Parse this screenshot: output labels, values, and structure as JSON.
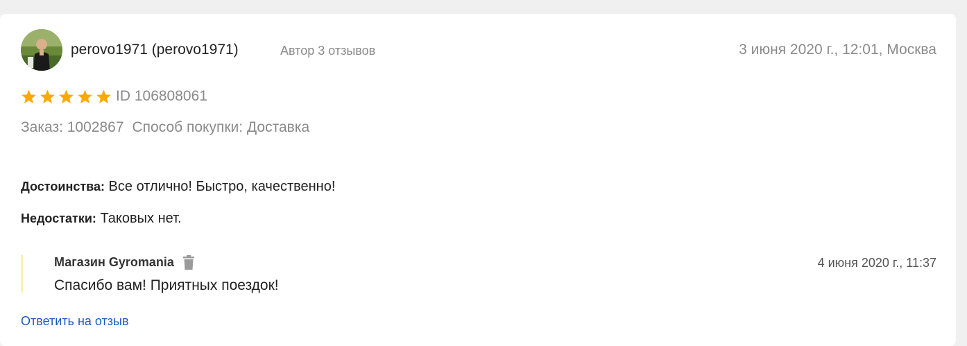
{
  "review": {
    "author_name": "perovo1971 (perovo1971)",
    "author_reviews_count": "Автор 3 отзывов",
    "date": "3 июня 2020 г., 12:01, Москва",
    "rating": {
      "value": 5,
      "max": 5,
      "star_color": "#ffa800"
    },
    "id_text": "ID 106808061",
    "order_text": "Заказ: 1002867",
    "purchase_method_text": "Способ покупки: Доставка",
    "pros_label": "Достоинства:",
    "pros_text": "Все отлично! Быстро, качественно!",
    "cons_label": "Недостатки:",
    "cons_text": "Таковых нет."
  },
  "shop_reply": {
    "shop_name": "Магазин Gyromania",
    "date": "4 июня 2020 г., 11:37",
    "text": "Спасибо вам! Приятных поездок!",
    "delete_icon": "trash-icon",
    "border_color": "#fcefb4"
  },
  "actions": {
    "reply_link": "Ответить на отзыв",
    "link_color": "#1a5bc0"
  }
}
